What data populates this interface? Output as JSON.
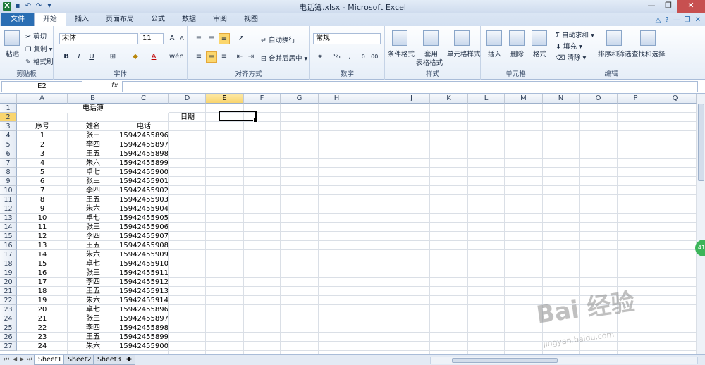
{
  "window": {
    "title": "电话簿.xlsx - Microsoft Excel"
  },
  "quick_access": [
    "save-icon",
    "undo-icon",
    "redo-icon"
  ],
  "tabs": {
    "file": "文件",
    "home": "开始",
    "insert": "插入",
    "page_layout": "页面布局",
    "formulas": "公式",
    "data": "数据",
    "review": "审阅",
    "view": "视图"
  },
  "ribbon": {
    "clipboard": {
      "paste": "粘贴",
      "cut": "剪切",
      "copy": "复制",
      "format_painter": "格式刷",
      "label": "剪贴板"
    },
    "font": {
      "name": "宋体",
      "size": "11",
      "bold": "B",
      "italic": "I",
      "underline": "U",
      "label": "字体",
      "wen": "wén"
    },
    "alignment": {
      "wrap": "自动换行",
      "merge": "合并后居中",
      "label": "对齐方式"
    },
    "number": {
      "format": "常规",
      "percent": "%",
      "comma": ",",
      "label": "数字"
    },
    "styles": {
      "conditional": "条件格式",
      "table_fmt_1": "套用",
      "table_fmt_2": "表格格式",
      "cell_style": "单元格样式",
      "label": "样式"
    },
    "cells": {
      "insert": "插入",
      "delete": "删除",
      "format": "格式",
      "label": "单元格"
    },
    "editing": {
      "autosum": "自动求和",
      "fill": "填充",
      "clear": "清除",
      "sort": "排序和筛选",
      "find": "查找和选择",
      "label": "编辑"
    }
  },
  "formula_bar": {
    "name_box": "E2",
    "fx": "fx",
    "value": ""
  },
  "columns": [
    "A",
    "B",
    "C",
    "D",
    "E",
    "F",
    "G",
    "H",
    "I",
    "J",
    "K",
    "L",
    "M",
    "N",
    "O",
    "P",
    "Q"
  ],
  "selected_column": "E",
  "selected_row": 2,
  "rows": [
    "1",
    "2",
    "3",
    "4",
    "5",
    "6",
    "7",
    "8",
    "9",
    "10",
    "11",
    "12",
    "13",
    "14",
    "15",
    "16",
    "17",
    "18",
    "19",
    "20",
    "21",
    "22",
    "23",
    "24",
    "25",
    "26",
    "27"
  ],
  "sheet": {
    "title": "电话簿",
    "date_label": "日期",
    "headers": {
      "seq": "序号",
      "name": "姓名",
      "phone": "电话"
    },
    "records": [
      [
        "1",
        "张三",
        "15942455896"
      ],
      [
        "2",
        "李四",
        "15942455897"
      ],
      [
        "3",
        "王五",
        "15942455898"
      ],
      [
        "4",
        "朱六",
        "15942455899"
      ],
      [
        "5",
        "卓七",
        "15942455900"
      ],
      [
        "6",
        "张三",
        "15942455901"
      ],
      [
        "7",
        "李四",
        "15942455902"
      ],
      [
        "8",
        "王五",
        "15942455903"
      ],
      [
        "9",
        "朱六",
        "15942455904"
      ],
      [
        "10",
        "卓七",
        "15942455905"
      ],
      [
        "11",
        "张三",
        "15942455906"
      ],
      [
        "12",
        "李四",
        "15942455907"
      ],
      [
        "13",
        "王五",
        "15942455908"
      ],
      [
        "14",
        "朱六",
        "15942455909"
      ],
      [
        "15",
        "卓七",
        "15942455910"
      ],
      [
        "16",
        "张三",
        "15942455911"
      ],
      [
        "17",
        "李四",
        "15942455912"
      ],
      [
        "18",
        "王五",
        "15942455913"
      ],
      [
        "19",
        "朱六",
        "15942455914"
      ],
      [
        "20",
        "卓七",
        "15942455896"
      ],
      [
        "21",
        "张三",
        "15942455897"
      ],
      [
        "22",
        "李四",
        "15942455898"
      ],
      [
        "23",
        "王五",
        "15942455899"
      ],
      [
        "24",
        "朱六",
        "15942455900"
      ]
    ]
  },
  "sheet_tabs": [
    "Sheet1",
    "Sheet2",
    "Sheet3"
  ],
  "side_badge": "41",
  "watermark": {
    "text": "Bai 经验",
    "url": "jingyan.baidu.com"
  }
}
